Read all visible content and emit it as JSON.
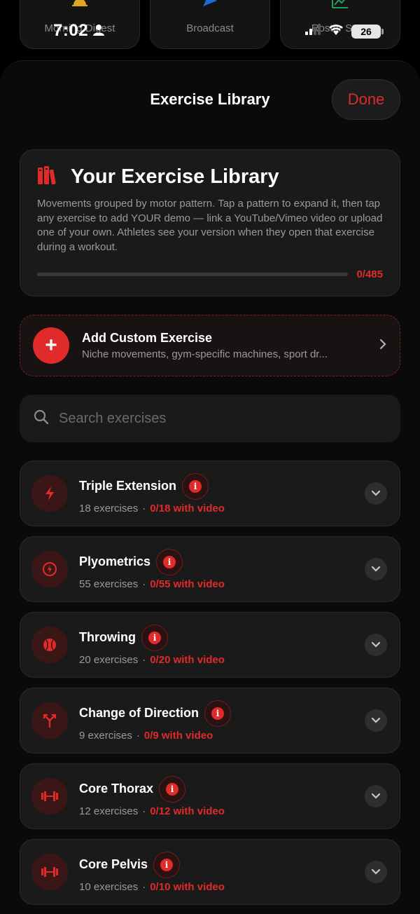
{
  "status_bar": {
    "time": "7:02",
    "battery": "26"
  },
  "background_tiles": [
    {
      "label": "Morning Digest",
      "icon": "sunrise-icon"
    },
    {
      "label": "Broadcast",
      "icon": "paper-plane-icon"
    },
    {
      "label": "Roster Stats",
      "icon": "chart-line-icon"
    }
  ],
  "sheet": {
    "title": "Exercise Library",
    "done_label": "Done"
  },
  "hero": {
    "icon": "books-icon",
    "title": "Your Exercise Library",
    "description": "Movements grouped by motor pattern. Tap a pattern to expand it, then tap any exercise to add YOUR demo — link a YouTube/Vimeo video or upload one of your own. Athletes see your version when they open that exercise during a workout.",
    "progress_text": "0/485",
    "progress_fraction": 0
  },
  "add_custom": {
    "title": "Add Custom Exercise",
    "subtitle": "Niche movements, gym-specific machines, sport dr..."
  },
  "search": {
    "placeholder": "Search exercises"
  },
  "categories": [
    {
      "name": "Triple Extension",
      "count": "18 exercises",
      "video": "0/18 with video",
      "icon": "bolt-icon"
    },
    {
      "name": "Plyometrics",
      "count": "55 exercises",
      "video": "0/55 with video",
      "icon": "speed-icon"
    },
    {
      "name": "Throwing",
      "count": "20 exercises",
      "video": "0/20 with video",
      "icon": "baseball-icon"
    },
    {
      "name": "Change of Direction",
      "count": "9 exercises",
      "video": "0/9 with video",
      "icon": "split-arrow-icon"
    },
    {
      "name": "Core Thorax",
      "count": "12 exercises",
      "video": "0/12 with video",
      "icon": "barbell-icon"
    },
    {
      "name": "Core Pelvis",
      "count": "10 exercises",
      "video": "0/10 with video",
      "icon": "barbell-icon"
    }
  ],
  "colors": {
    "accent": "#e12a2a",
    "card": "#1a1a1a",
    "background": "#0a0a0a"
  },
  "separator": "·"
}
